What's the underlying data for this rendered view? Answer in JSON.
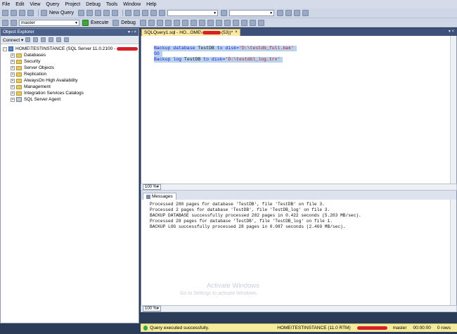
{
  "menu": [
    "File",
    "Edit",
    "View",
    "Query",
    "Project",
    "Debug",
    "Tools",
    "Window",
    "Help"
  ],
  "toolbar": {
    "new_query": "New Query",
    "database": "master",
    "execute": "Execute",
    "debug": "Debug"
  },
  "object_explorer": {
    "title": "Object Explorer",
    "connect": "Connect ▾",
    "server": "HOME\\TESTINSTANCE (SQL Server 11.0.2100 -",
    "nodes": [
      "Databases",
      "Security",
      "Server Objects",
      "Replication",
      "AlwaysOn High Availability",
      "Management",
      "Integration Services Catalogs",
      "SQL Server Agent"
    ]
  },
  "editor": {
    "tab_label": "SQLQuery1.sql - HO...OME\\",
    "tab_suffix": "(53))*",
    "lines": [
      {
        "kw1": "Backup database ",
        "obj": "TestDB",
        "kw2": " to disk=",
        "str": "'D:\\testdb_full.bak'"
      },
      {
        "kw1": "GO",
        "obj": "",
        "kw2": "",
        "str": ""
      },
      {
        "kw1": "Backup log ",
        "obj": "TestDB",
        "kw2": " to disk=",
        "str": "'D:\\testdbl_log.trn'"
      }
    ],
    "zoom": "100 %"
  },
  "results": {
    "tab": "Messages",
    "messages": [
      "Processed 280 pages for database 'TestDB', file 'TestDB' on file 3.",
      "Processed 2 pages for database 'TestDB', file 'TestDB_log' on file 3.",
      "BACKUP DATABASE successfully processed 282 pages in 0.422 seconds (5.203 MB/sec).",
      "Processed 28 pages for database 'TestDB', file 'TestDB_log' on file 1.",
      "BACKUP LOG successfully processed 28 pages in 0.087 seconds (2.469 MB/sec)."
    ],
    "zoom": "100 %"
  },
  "watermark": {
    "title": "Activate Windows",
    "subtitle": "Go to Settings to activate Windows."
  },
  "status": {
    "message": "Query executed successfully.",
    "server": "HOME\\TESTINSTANCE (11.0 RTM)",
    "database": "master",
    "elapsed": "00:00:00",
    "rows": "0 rows"
  }
}
